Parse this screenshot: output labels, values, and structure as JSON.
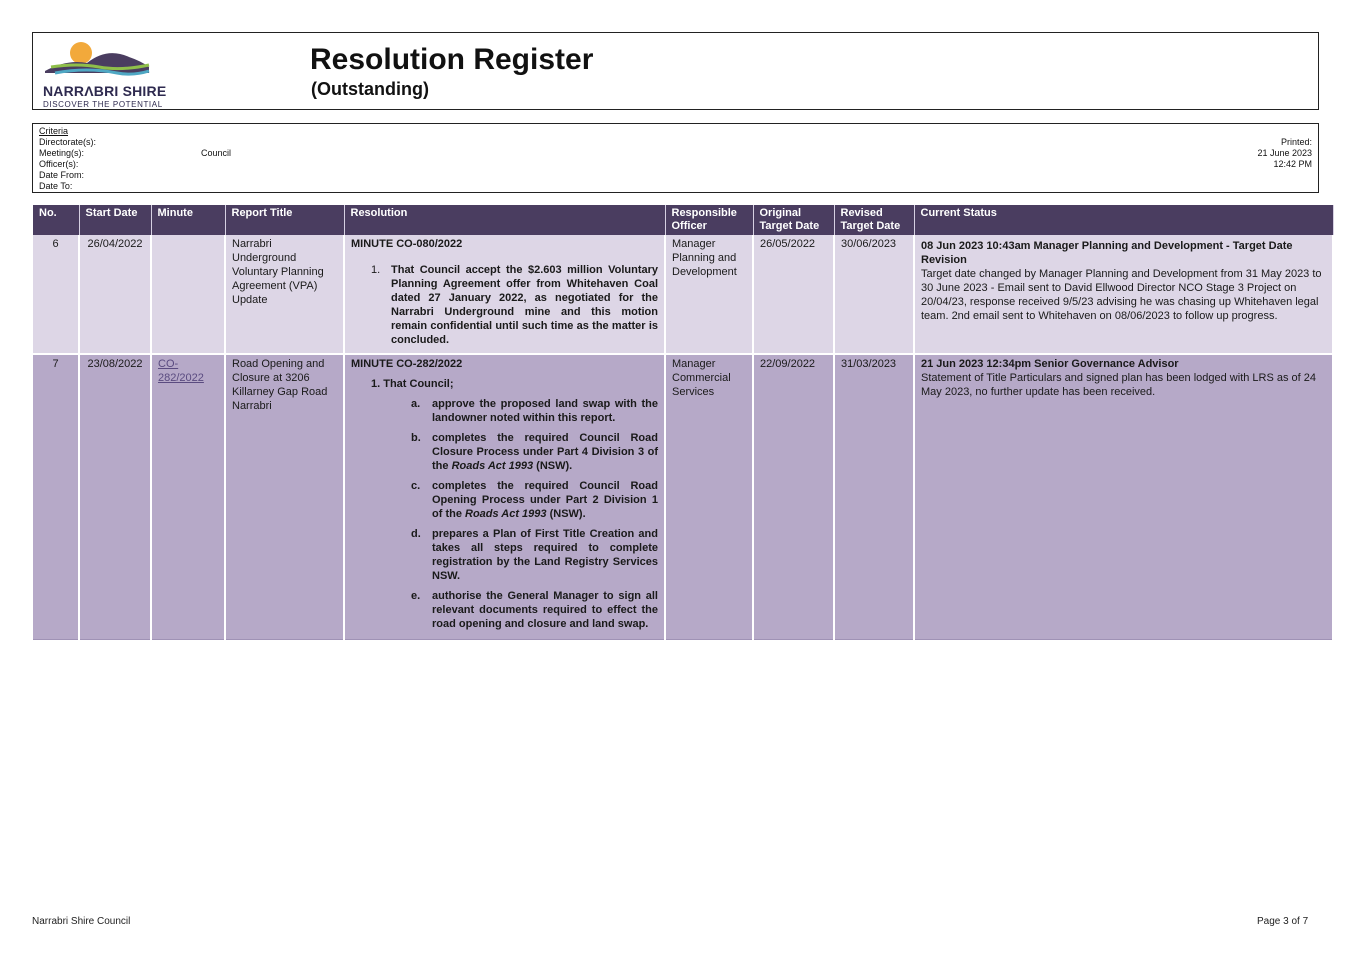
{
  "header": {
    "logo_name": "NARRΛBRI SHIRE",
    "logo_tagline": "DISCOVER THE POTENTIAL",
    "title": "Resolution Register",
    "subtitle": "(Outstanding)"
  },
  "criteria": {
    "heading": "Criteria",
    "directorates_label": "Directorate(s):",
    "meetings_label": "Meeting(s):",
    "meetings_value": "Council",
    "officers_label": "Officer(s):",
    "date_from_label": "Date From:",
    "date_to_label": "Date To:",
    "printed_label": "Printed:",
    "printed_date": "21 June 2023",
    "printed_time": "12:42 PM"
  },
  "table": {
    "columns": [
      "No.",
      "Start Date",
      "Minute",
      "Report Title",
      "Resolution",
      "Responsible Officer",
      "Original Target Date",
      "Revised Target Date",
      "Current Status"
    ],
    "rows": [
      {
        "no": "6",
        "start_date": "26/04/2022",
        "minute": "",
        "report_title": "Narrabri Underground Voluntary Planning Agreement (VPA) Update",
        "resolution_heading": "MINUTE CO-080/2022",
        "resolution_items": [
          {
            "num": "1.",
            "text": "That Council accept the $2.603 million Voluntary Planning Agreement offer from Whitehaven Coal dated 27 January 2022, as negotiated for the Narrabri Underground mine and this motion remain confidential until such time as the matter is concluded."
          }
        ],
        "officer": "Manager Planning and Development",
        "original_target": "26/05/2022",
        "revised_target": "30/06/2023",
        "status_heading": "08 Jun 2023 10:43am Manager Planning and Development - Target Date Revision",
        "status_body": "Target date changed by Manager Planning and Development from 31 May 2023 to 30 June 2023 - Email sent to David Ellwood Director NCO Stage 3 Project on 20/04/23, response received 9/5/23 advising he was chasing up Whitehaven legal team. 2nd email sent to Whitehaven on 08/06/2023 to follow up progress."
      },
      {
        "no": "7",
        "start_date": "23/08/2022",
        "minute": "CO-282/2022",
        "report_title": "Road Opening and Closure at 3206 Killarney Gap Road Narrabri",
        "resolution_heading": "MINUTE  CO-282/2022",
        "resolution_intro": "1. That Council;",
        "resolution_subitems": [
          {
            "letter": "a.",
            "text": " approve the proposed land swap with the landowner noted within this report."
          },
          {
            "letter": "b.",
            "text_before": "completes the required Council Road Closure Process under Part 4 Division 3 of the ",
            "italic": "Roads Act 1993",
            "text_after": " (NSW)."
          },
          {
            "letter": "c.",
            "text_before": "completes the required Council Road Opening Process under Part 2 Division 1 of the ",
            "italic": "Roads Act 1993",
            "text_after": " (NSW)."
          },
          {
            "letter": "d.",
            "text": "prepares a Plan of First Title Creation and takes all steps required to complete registration by the Land Registry Services NSW."
          },
          {
            "letter": "e.",
            "text": "authorise the General Manager to sign all relevant documents required to effect the road opening and closure and land swap."
          }
        ],
        "officer": "Manager Commercial Services",
        "original_target": "22/09/2022",
        "revised_target": "31/03/2023",
        "status_heading": "21 Jun 2023 12:34pm Senior Governance Advisor",
        "status_body": "Statement of Title Particulars and signed plan has been lodged with LRS as of 24 May 2023, no further update has been received."
      }
    ]
  },
  "footer": {
    "org": "Narrabri Shire Council",
    "page": "Page 3 of 7"
  },
  "colors": {
    "header_bg": "#4a3d60",
    "row_light": "#ddd6e6",
    "row_dark": "#b6a9c8",
    "link": "#5a4b80"
  }
}
